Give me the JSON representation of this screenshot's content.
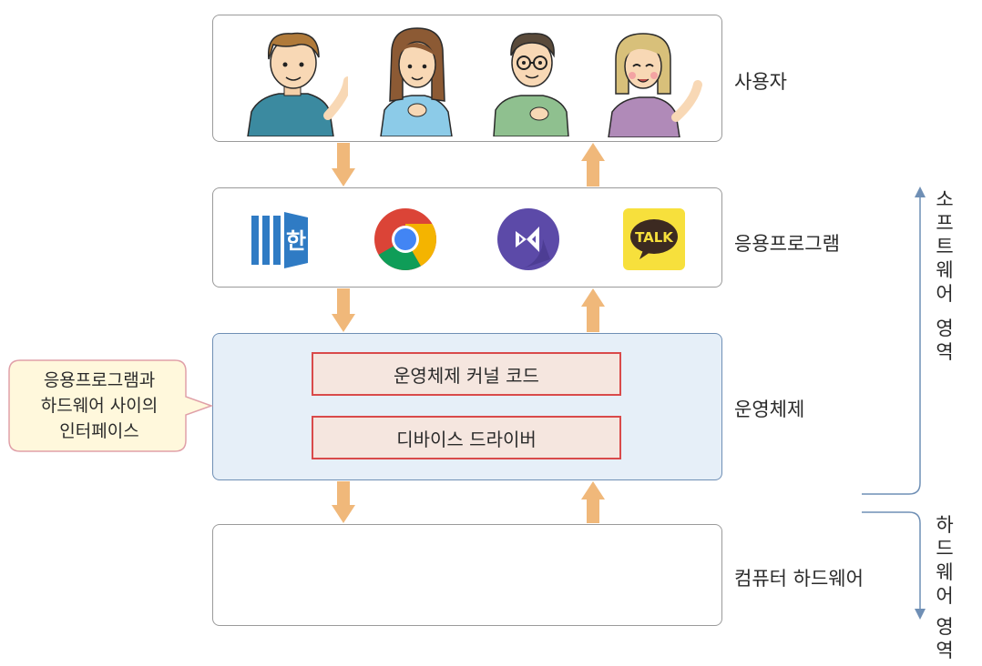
{
  "layers": {
    "users_label": "사용자",
    "apps_label": "응용프로그램",
    "os_label": "운영체제",
    "hw_label": "컴퓨터 하드웨어"
  },
  "os": {
    "kernel_label": "운영체제 커널 코드",
    "driver_label": "디바이스 드라이버"
  },
  "callout": {
    "line1": "응용프로그램과",
    "line2": "하드웨어 사이의",
    "line3": "인터페이스"
  },
  "side": {
    "software_line1": "소프트웨어",
    "software_line2": "영역",
    "hardware_line1": "하드웨어",
    "hardware_line2": "영역"
  },
  "apps": {
    "hangul_text": "한",
    "kakao_text": "TALK"
  },
  "colors": {
    "arrow": "#f0b87a",
    "os_fill": "#e6eff8",
    "os_border": "#6f8fb5",
    "inner_fill": "#f5e6df",
    "inner_border": "#d94a4a",
    "callout_fill": "#fff8dc",
    "callout_border": "#e0a0a8",
    "bracket": "#6f8fb5"
  },
  "icons": [
    "person-icon",
    "person-icon",
    "person-icon",
    "person-icon",
    "hangul-icon",
    "chrome-icon",
    "visual-studio-icon",
    "kakaotalk-icon"
  ]
}
